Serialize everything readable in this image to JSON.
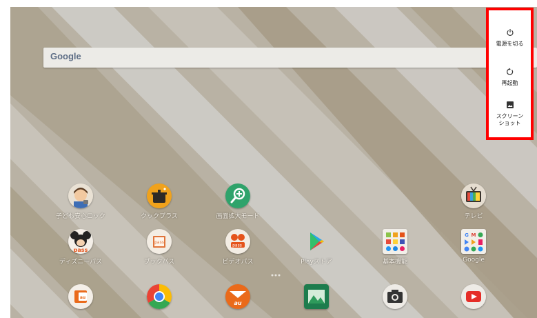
{
  "search": {
    "logo_text": "Google"
  },
  "apps": [
    {
      "label": "子ども安心ロック",
      "icon": "child-lock-icon"
    },
    {
      "label": "クックプラス",
      "icon": "cooking-pot-icon"
    },
    {
      "label": "画面拡大モード",
      "icon": "magnifier-icon"
    },
    {
      "label": "テレビ",
      "icon": "tv-icon"
    },
    {
      "label": "ディズニーパス",
      "icon": "disney-pass-icon"
    },
    {
      "label": "ブックパス",
      "icon": "book-pass-icon"
    },
    {
      "label": "ビデオパス",
      "icon": "video-pass-icon"
    },
    {
      "label": "Playストア",
      "icon": "play-store-icon"
    },
    {
      "label": "基本機能",
      "icon": "folder-basic-icon"
    },
    {
      "label": "Google",
      "icon": "folder-google-icon"
    },
    {
      "label": "",
      "icon": "au-app-icon"
    },
    {
      "label": "",
      "icon": "chrome-icon"
    },
    {
      "label": "",
      "icon": "au-mail-icon"
    },
    {
      "label": "",
      "icon": "gallery-icon"
    },
    {
      "label": "",
      "icon": "camera-icon"
    },
    {
      "label": "",
      "icon": "youtube-icon"
    }
  ],
  "power_menu": {
    "highlight_color": "#ff0000",
    "items": [
      {
        "label": "電源を切る",
        "icon": "power-icon"
      },
      {
        "label": "再起動",
        "icon": "restart-icon"
      },
      {
        "label": "スクリーン\nショット",
        "label_lines": [
          "スクリーン",
          "ショット"
        ],
        "icon": "screenshot-icon"
      }
    ]
  }
}
